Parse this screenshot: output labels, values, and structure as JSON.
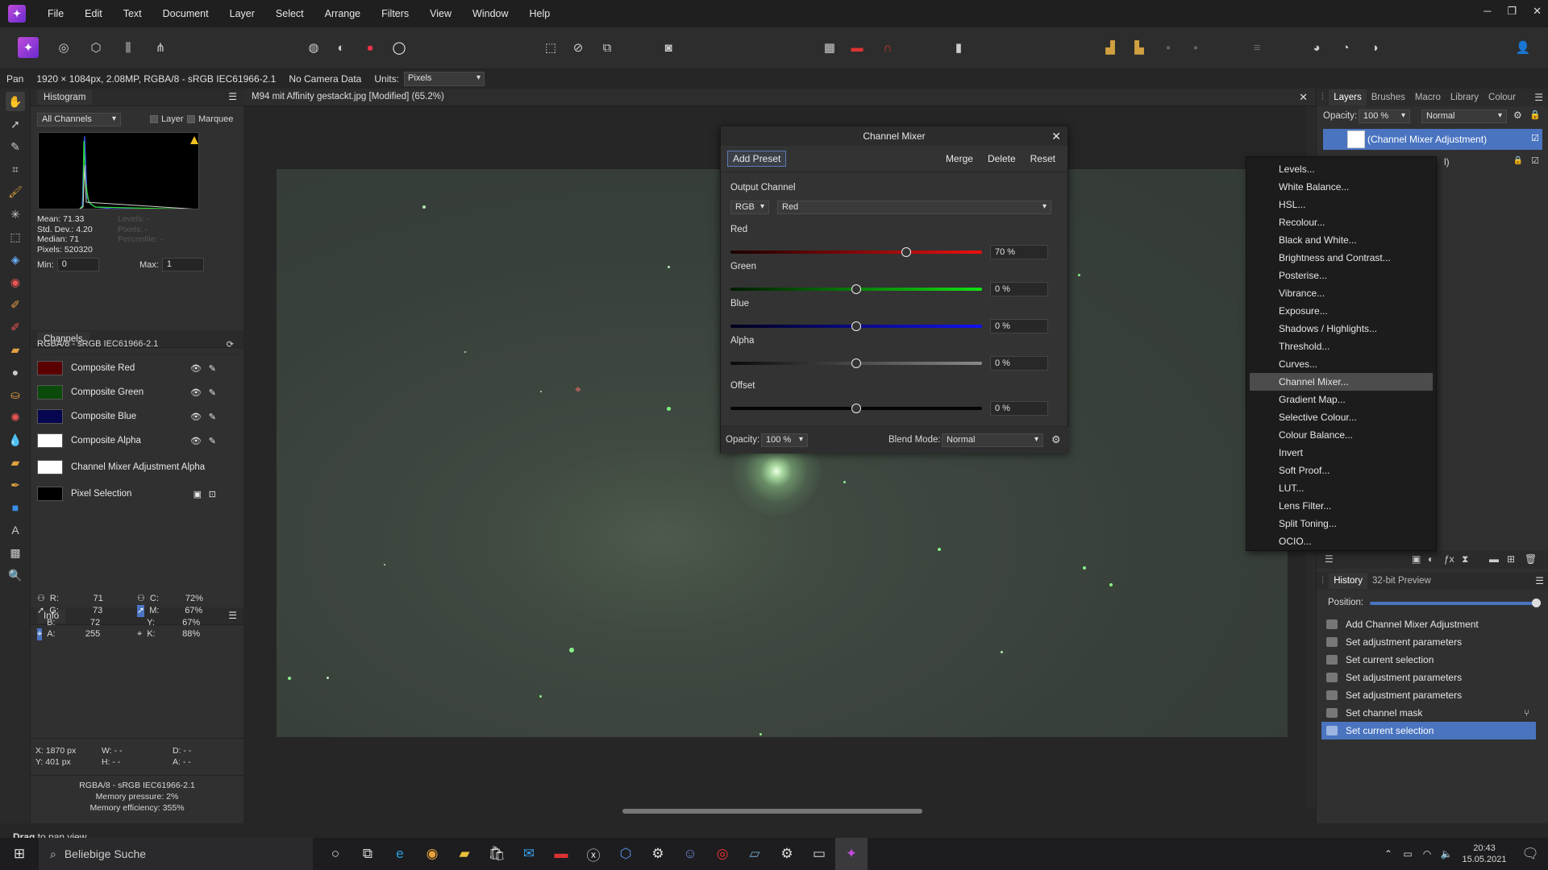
{
  "menubar": {
    "items": [
      "File",
      "Edit",
      "Text",
      "Document",
      "Layer",
      "Select",
      "Arrange",
      "Filters",
      "View",
      "Window",
      "Help"
    ]
  },
  "context": {
    "tool": "Pan",
    "doc_info": "1920 × 1084px, 2.08MP, RGBA/8 - sRGB IEC61966-2.1",
    "camera": "No Camera Data",
    "units_label": "Units:",
    "units_value": "Pixels"
  },
  "histogram": {
    "title": "Histogram",
    "channel": "All Channels",
    "layer_label": "Layer",
    "marquee_label": "Marquee",
    "mean": "Mean: 71.33",
    "stddev": "Std. Dev.: 4.20",
    "median": "Median: 71",
    "pixels": "Pixels: 520320",
    "levels": "Levels: -",
    "pixels2": "Pixels: -",
    "percentile": "Percentile: -",
    "min_label": "Min:",
    "min": "0",
    "max_label": "Max:",
    "max": "1"
  },
  "channels": {
    "title": "Channels",
    "profile": "RGBA/8 - sRGB IEC61966-2.1",
    "items": [
      {
        "name": "Composite Red",
        "color": "#5a0000"
      },
      {
        "name": "Composite Green",
        "color": "#0b4a0b"
      },
      {
        "name": "Composite Blue",
        "color": "#050550"
      },
      {
        "name": "Composite Alpha",
        "color": "#ffffff"
      },
      {
        "name": "Channel Mixer Adjustment Alpha",
        "color": "#ffffff"
      },
      {
        "name": "Pixel Selection",
        "color": "#000000"
      }
    ]
  },
  "info": {
    "title": "Info",
    "r_label": "R:",
    "r": "71",
    "g_label": "G:",
    "g": "73",
    "b_label": "B:",
    "b": "72",
    "a_label": "A:",
    "a": "255",
    "c_label": "C:",
    "c": "72%",
    "m_label": "M:",
    "m": "67%",
    "y_label": "Y:",
    "y": "67%",
    "k_label": "K:",
    "k": "88%",
    "x": "X: 1870 px",
    "ypos": "Y: 401 px",
    "w": "W: - -",
    "h": "H: - -",
    "d": "D: - -",
    "ang": "A: - -",
    "profile": "RGBA/8 - sRGB IEC61966-2.1",
    "mem_pressure": "Memory pressure: 2%",
    "mem_eff": "Memory efficiency: 355%"
  },
  "document": {
    "tab_title": "M94 mit Affinity gestackt.jpg [Modified] (65.2%)"
  },
  "mixer": {
    "title": "Channel Mixer",
    "add_preset": "Add Preset",
    "merge": "Merge",
    "delete": "Delete",
    "reset": "Reset",
    "output_label": "Output Channel",
    "output_space": "RGB",
    "output_channel": "Red",
    "sliders": [
      {
        "label": "Red",
        "value": "70 %",
        "level": 0.7
      },
      {
        "label": "Green",
        "value": "0 %",
        "level": 0.5
      },
      {
        "label": "Blue",
        "value": "0 %",
        "level": 0.5
      },
      {
        "label": "Alpha",
        "value": "0 %",
        "level": 0.5
      },
      {
        "label": "Offset",
        "value": "0 %",
        "level": 0.5
      }
    ],
    "opacity_label": "Opacity:",
    "opacity": "100 %",
    "blend_label": "Blend Mode:",
    "blend": "Normal"
  },
  "layers": {
    "tabs": [
      "Layers",
      "Brushes",
      "Macro",
      "Library",
      "Colour"
    ],
    "opacity_label": "Opacity:",
    "opacity": "100 %",
    "blend": "Normal",
    "row1": "(Channel Mixer Adjustment)",
    "row2_suffix": "l)"
  },
  "adjust_menu": {
    "items": [
      "Levels...",
      "White Balance...",
      "HSL...",
      "Recolour...",
      "Black and White...",
      "Brightness and Contrast...",
      "Posterise...",
      "Vibrance...",
      "Exposure...",
      "Shadows / Highlights...",
      "Threshold...",
      "Curves...",
      "Channel Mixer...",
      "Gradient Map...",
      "Selective Colour...",
      "Colour Balance...",
      "Invert",
      "Soft Proof...",
      "LUT...",
      "Lens Filter...",
      "Split Toning...",
      "OCIO..."
    ],
    "selected": "Channel Mixer..."
  },
  "history": {
    "tabs": [
      "History",
      "32-bit Preview"
    ],
    "position_label": "Position:",
    "items": [
      "Add Channel Mixer Adjustment",
      "Set adjustment parameters",
      "Set current selection",
      "Set adjustment parameters",
      "Set adjustment parameters",
      "Set channel mask",
      "Set current selection"
    ]
  },
  "status": {
    "bold": "Drag",
    "rest": " to pan view."
  },
  "taskbar": {
    "search_placeholder": "Beliebige Suche",
    "time": "20:43",
    "date": "15.05.2021"
  },
  "colors": {
    "accent": "#4a74c0",
    "red_slider": "#e01010",
    "green_slider": "#10d010",
    "blue_slider": "#1010e0"
  }
}
